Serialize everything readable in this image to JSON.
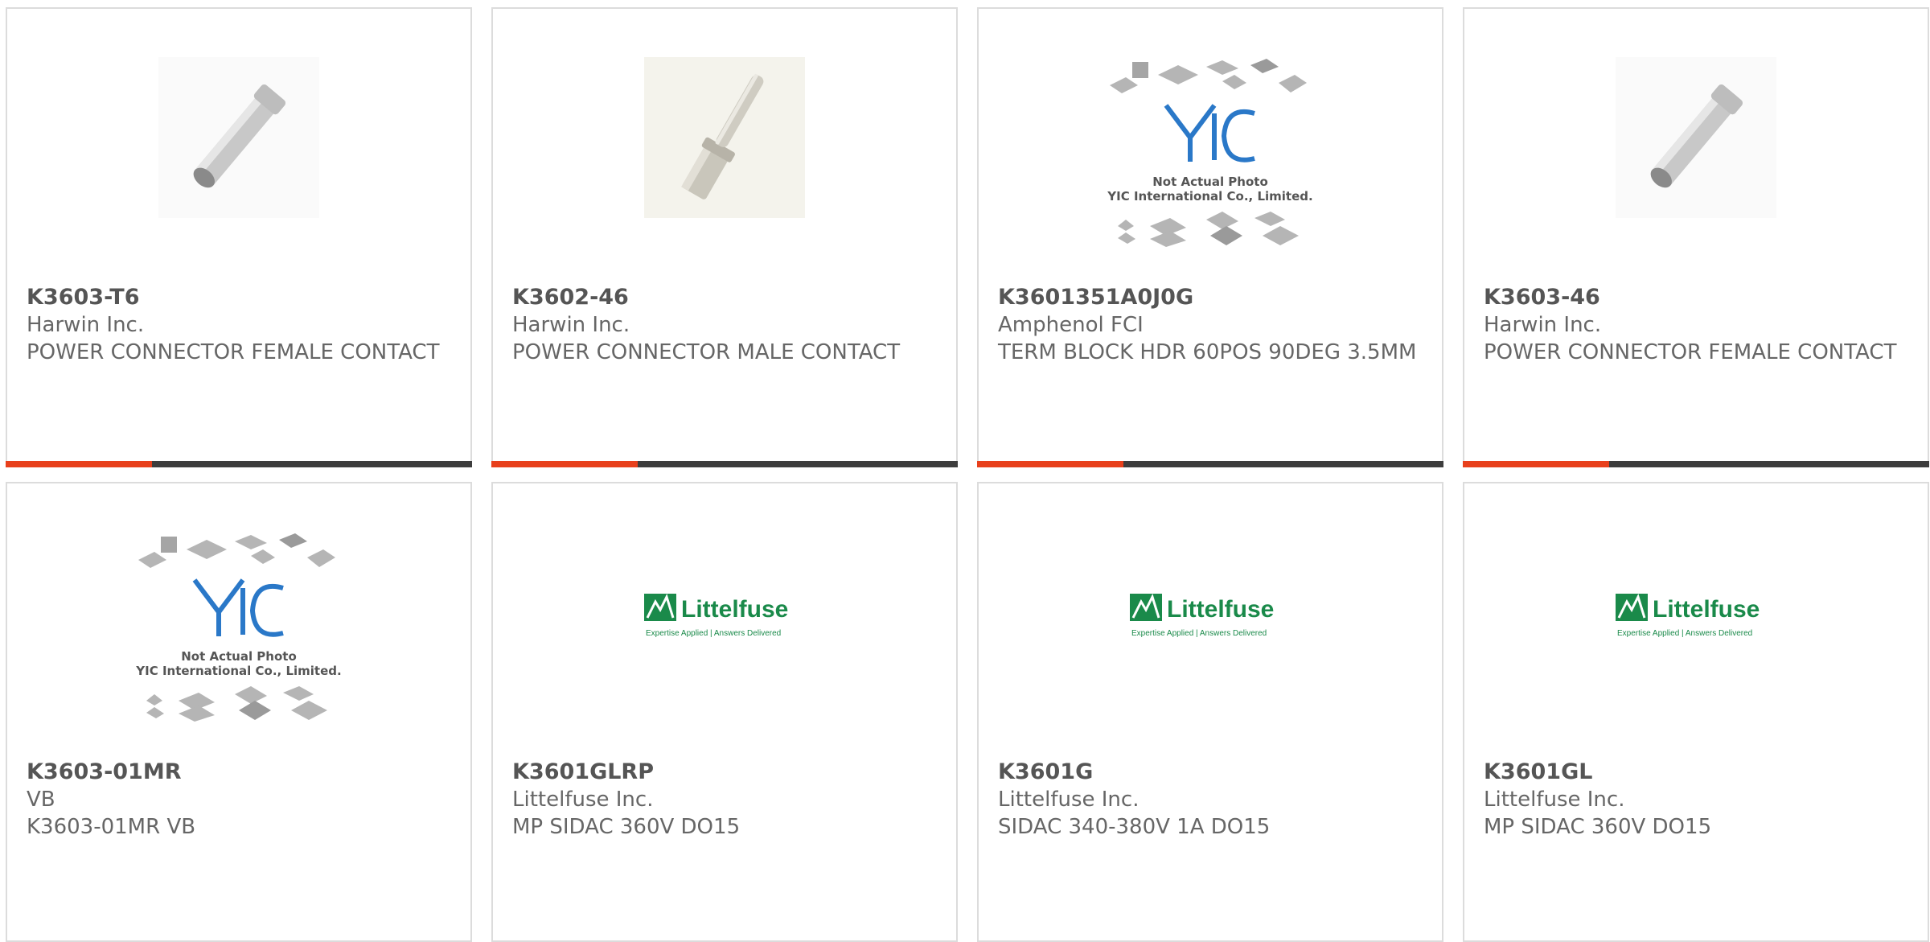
{
  "products": [
    {
      "part": "K3603-T6",
      "mfr": "Harwin Inc.",
      "desc": "POWER CONNECTOR FEMALE CONTACT",
      "image": "pin-female-photo"
    },
    {
      "part": "K3602-46",
      "mfr": "Harwin Inc.",
      "desc": "POWER CONNECTOR MALE CONTACT",
      "image": "pin-male-photo"
    },
    {
      "part": "K3601351A0J0G",
      "mfr": "Amphenol FCI",
      "desc": "TERM BLOCK HDR 60POS 90DEG 3.5MM",
      "image": "yic-placeholder"
    },
    {
      "part": "K3603-46",
      "mfr": "Harwin Inc.",
      "desc": "POWER CONNECTOR FEMALE CONTACT",
      "image": "pin-female-photo"
    },
    {
      "part": "K3603-01MR",
      "mfr": "VB",
      "desc": "K3603-01MR VB",
      "image": "yic-placeholder"
    },
    {
      "part": "K3601GLRP",
      "mfr": "Littelfuse Inc.",
      "desc": "MP SIDAC 360V DO15",
      "image": "littelfuse-logo"
    },
    {
      "part": "K3601G",
      "mfr": "Littelfuse Inc.",
      "desc": "SIDAC 340-380V 1A DO15",
      "image": "littelfuse-logo"
    },
    {
      "part": "K3601GL",
      "mfr": "Littelfuse Inc.",
      "desc": "MP SIDAC 360V DO15",
      "image": "littelfuse-logo"
    }
  ],
  "placeholder": {
    "line1": "Not Actual Photo",
    "line2": "YIC International Co., Limited."
  },
  "littelfuse": {
    "brand": "Littelfuse",
    "tagline": "Expertise Applied | Answers Delivered"
  },
  "colors": {
    "accent": "#e8401c",
    "bar": "#3d3d3d",
    "border": "#dcdcdc",
    "littelfuse_green": "#1a8a4a",
    "yic_blue": "#2a78c8"
  }
}
